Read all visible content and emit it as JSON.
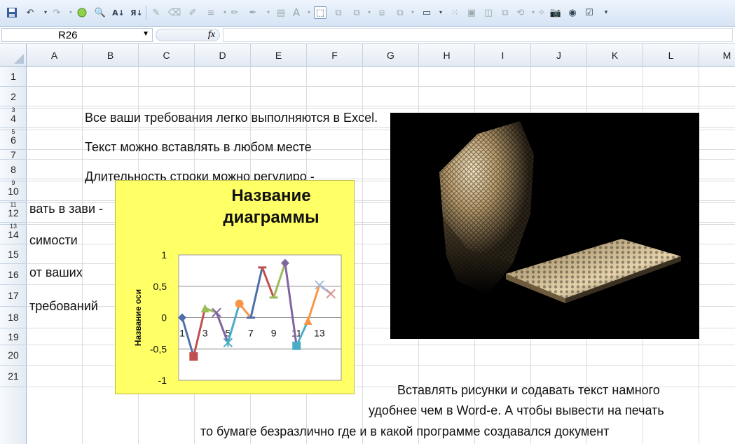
{
  "toolbar": {
    "buttons": [
      "save-icon",
      "undo-icon",
      "redo-icon",
      "circle-icon",
      "print-preview-icon",
      "sort-ascending-icon",
      "sort-descending-icon",
      "draw-line-icon",
      "eraser-icon",
      "pen-icon",
      "line-style-icon",
      "pencil-icon",
      "line-color-icon",
      "wordart-icon",
      "select-objects-icon",
      "group-icon",
      "ungroup-icon",
      "bring-forward-icon",
      "send-backward-icon",
      "text-box-icon",
      "align-icon",
      "distribute-icon",
      "shape-icon",
      "copy-shape-icon",
      "rotate-icon",
      "paint-icon",
      "camera-icon",
      "radio-button-icon",
      "checkbox-icon",
      "customize-icon"
    ]
  },
  "formula_bar": {
    "name_box": "R26",
    "fx_label": "fx",
    "formula": ""
  },
  "columns": [
    "A",
    "B",
    "C",
    "D",
    "E",
    "F",
    "G",
    "H",
    "I",
    "J",
    "K",
    "L",
    "M"
  ],
  "rows": [
    "1",
    "2",
    "3",
    "4",
    "5",
    "6",
    "7",
    "8",
    "9",
    "10",
    "11",
    "12",
    "13",
    "14",
    "15",
    "16",
    "17",
    "18",
    "19",
    "20",
    "21"
  ],
  "cells": {
    "r2": "Все ваши требования легко выполняются в Excel.",
    "r4": "Текст можно вставлять в любом  месте",
    "r6": "Длительность строки можно регулиро -",
    "r8": "вать в  зави -",
    "r10": "симости",
    "r12": "от  ваших",
    "r14": "требований",
    "r18": "Вставлять рисунки и содавать текст намного",
    "r19": "удобнее чем  в Word-е.  А чтобы вывести на печать",
    "r20": "то бумаге безразлично где и в какой программе создавался документ"
  },
  "chart_data": {
    "type": "line",
    "title": "Название диаграммы",
    "title_lines": [
      "Название",
      "диаграммы"
    ],
    "ylabel": "Название оси",
    "xlabel": "",
    "ylim": [
      -1,
      1
    ],
    "y_ticks": [
      "1",
      "0,5",
      "0",
      "-0,5",
      "-1"
    ],
    "x_ticks": [
      "1",
      "3",
      "5",
      "7",
      "9",
      "11",
      "13"
    ],
    "background": "#ffff66",
    "segments": [
      {
        "x": [
          1,
          2
        ],
        "y": [
          0,
          -0.62
        ],
        "color": "#4f6fa8",
        "marker": "diamond"
      },
      {
        "x": [
          2,
          3
        ],
        "y": [
          -0.62,
          0.15
        ],
        "color": "#c0504d",
        "marker": "square"
      },
      {
        "x": [
          3,
          4
        ],
        "y": [
          0.15,
          0.08
        ],
        "color": "#9bbb59",
        "marker": "triangle"
      },
      {
        "x": [
          4,
          5
        ],
        "y": [
          0.08,
          -0.4
        ],
        "color": "#8064a2",
        "marker": "x"
      },
      {
        "x": [
          5,
          6
        ],
        "y": [
          -0.4,
          0.22
        ],
        "color": "#4bacc6",
        "marker": "star"
      },
      {
        "x": [
          6,
          7
        ],
        "y": [
          0.22,
          0
        ],
        "color": "#f79646",
        "marker": "circle"
      },
      {
        "x": [
          7,
          8
        ],
        "y": [
          0,
          0.8
        ],
        "color": "#4f6fa8",
        "marker": "dash"
      },
      {
        "x": [
          8,
          9
        ],
        "y": [
          0.8,
          0.32
        ],
        "color": "#c0504d",
        "marker": "dash"
      },
      {
        "x": [
          9,
          10
        ],
        "y": [
          0.32,
          0.87
        ],
        "color": "#9bbb59",
        "marker": "dash"
      },
      {
        "x": [
          10,
          11
        ],
        "y": [
          0.87,
          -0.45
        ],
        "color": "#8064a2",
        "marker": "diamond"
      },
      {
        "x": [
          11,
          12
        ],
        "y": [
          -0.45,
          -0.05
        ],
        "color": "#4bacc6",
        "marker": "square"
      },
      {
        "x": [
          12,
          13
        ],
        "y": [
          -0.05,
          0.52
        ],
        "color": "#f79646",
        "marker": "triangle"
      },
      {
        "x": [
          13,
          14
        ],
        "y": [
          0.52,
          0.38
        ],
        "color": "#a4b9d8",
        "marker": "x"
      },
      {
        "x": [
          14,
          14
        ],
        "y": [
          0.38,
          0.38
        ],
        "color": "#d99694",
        "marker": "x"
      }
    ]
  },
  "picture": {
    "subject": "illuminated honeycomb-lattice 3D sculpture on black background"
  }
}
